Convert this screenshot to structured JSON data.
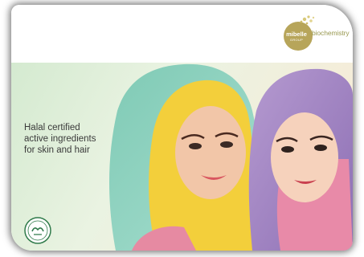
{
  "brand": {
    "logo_word": "mibelle",
    "logo_sub": "GROUP",
    "division": "biochemistry"
  },
  "tagline": {
    "line1": "Halal certified",
    "line2": "active ingredients",
    "line3": "for skin and hair"
  },
  "halal_badge": {
    "label": "حلال",
    "sub": "HALAL"
  },
  "colors": {
    "brand_olive": "#9a9a52",
    "logo_gold": "#b7a55a",
    "banner_green": "#c9e3c4",
    "scarf_teal": "#8fd2bf",
    "scarf_yellow": "#f3cf3b",
    "scarf_purple": "#a98cc6"
  }
}
